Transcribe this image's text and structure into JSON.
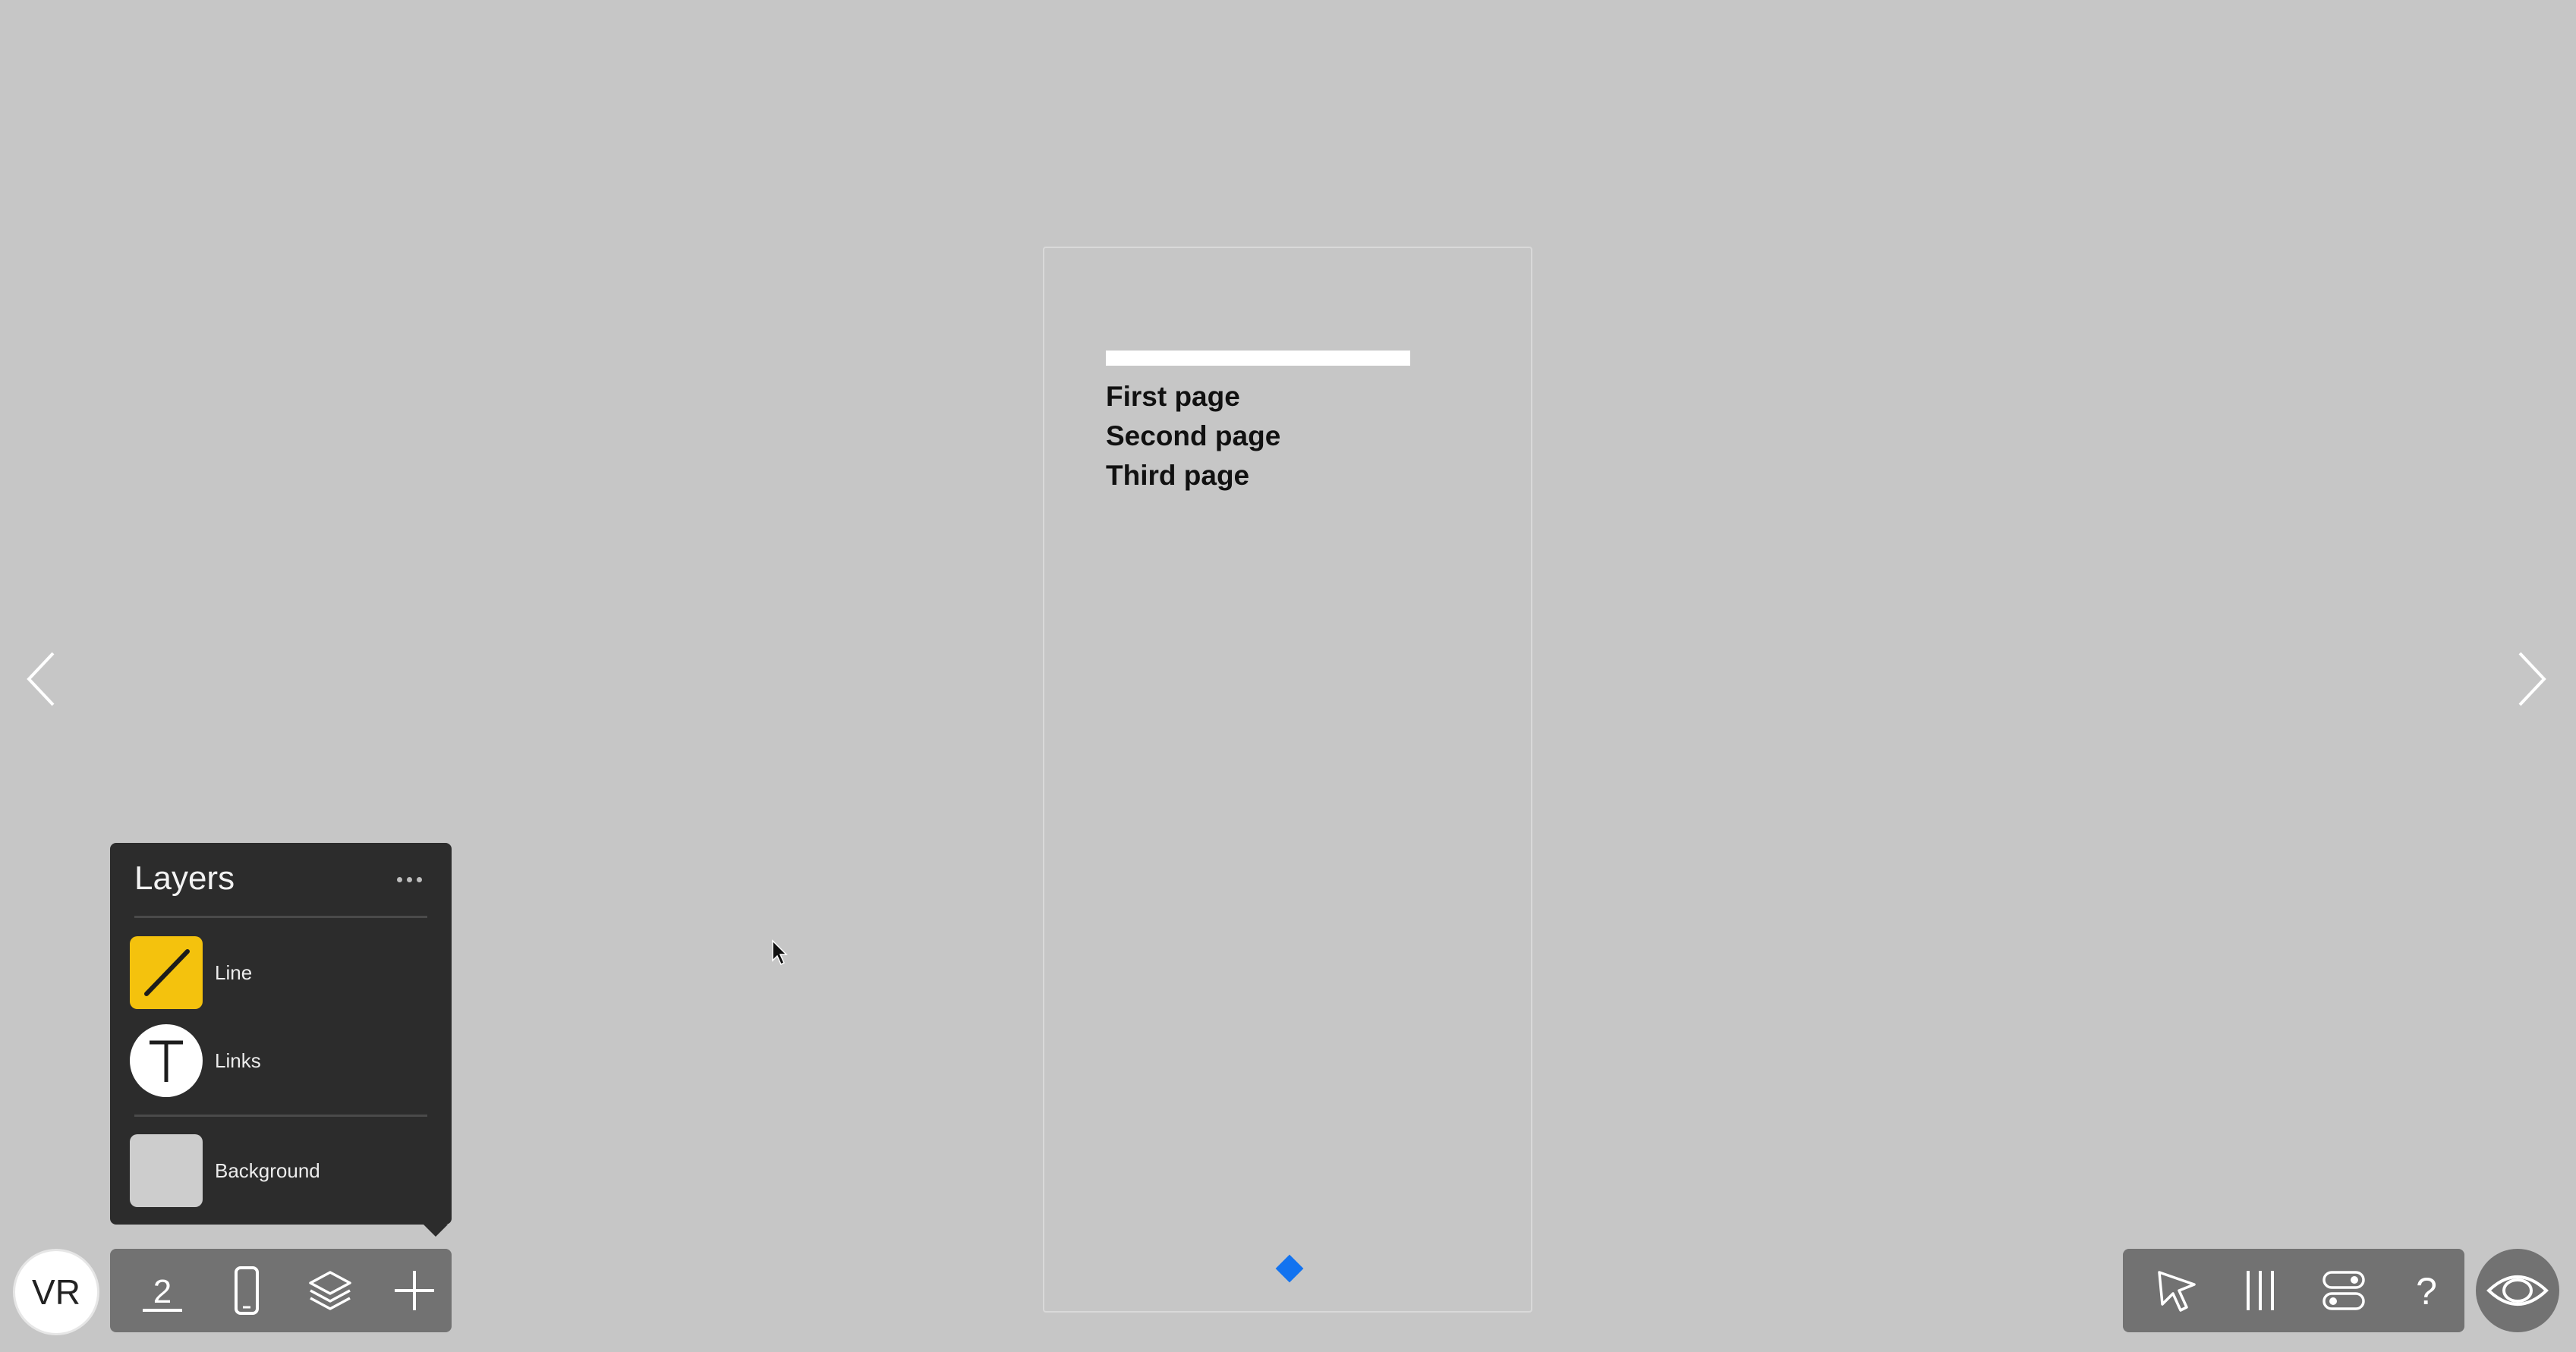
{
  "device": {
    "links": [
      {
        "label": "First page"
      },
      {
        "label": "Second page"
      },
      {
        "label": "Third page"
      }
    ],
    "accent_color": "#1273f0"
  },
  "nav": {
    "prev_icon": "chevron-left-icon",
    "next_icon": "chevron-right-icon"
  },
  "layers_panel": {
    "title": "Layers",
    "more_icon": "more-horizontal-icon",
    "layers": [
      {
        "label": "Line",
        "icon": "diagonal-line-icon",
        "thumb_color": "#f4c20d"
      },
      {
        "label": "Links",
        "icon": "text-t-icon",
        "thumb_color": "#ffffff"
      },
      {
        "label": "Background",
        "icon": "background-swatch-icon",
        "thumb_color": "#cdcdcd"
      }
    ]
  },
  "avatar": {
    "initials": "VR"
  },
  "left_toolbar": {
    "page_number": "2",
    "buttons": [
      "page-number-icon",
      "phone-device-icon",
      "layers-icon",
      "plus-icon"
    ]
  },
  "right_toolbar": {
    "buttons": [
      "pointer-icon",
      "columns-icon",
      "toggles-icon",
      "help-icon"
    ],
    "help_glyph": "?"
  },
  "preview_button": {
    "icon": "eye-icon"
  }
}
